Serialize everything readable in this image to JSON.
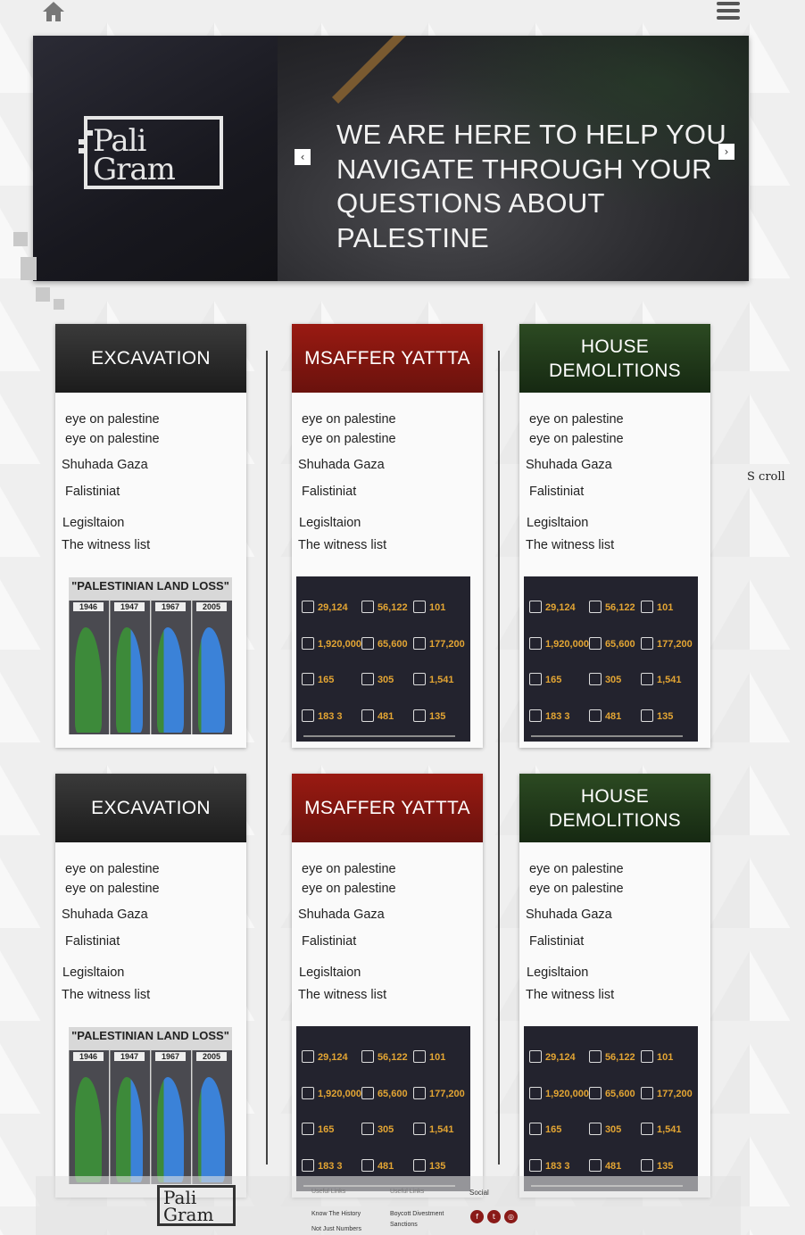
{
  "hero": {
    "logo_text": "Pali Gram",
    "headline": "WE ARE HERE TO HELP YOU NAVIGATE THROUGH YOUR QUESTIONS ABOUT PALESTINE",
    "prev_symbol": "‹",
    "next_symbol": "›"
  },
  "scroll_label": "S croll",
  "cards": [
    {
      "title": "EXCAVATION",
      "links": [
        "eye on palestine",
        "eye on palestine",
        "Shuhada Gaza",
        "Falistiniat",
        "Legisltaion",
        "The witness list"
      ],
      "image": "palestinian-land-loss-map"
    },
    {
      "title": "MSAFFER YATTTA",
      "links": [
        "eye on palestine",
        "eye on palestine",
        "Shuhada Gaza",
        "Falistiniat",
        "Legisltaion",
        "The witness list"
      ],
      "image": "gaza-statistics-infographic"
    },
    {
      "title": "HOUSE DEMOLITIONS",
      "links": [
        "eye on palestine",
        "eye on palestine",
        "Shuhada Gaza",
        "Falistiniat",
        "Legisltaion",
        "The witness list"
      ],
      "image": "gaza-statistics-infographic"
    },
    {
      "title": "EXCAVATION",
      "links": [
        "eye on palestine",
        "eye on palestine",
        "Shuhada Gaza",
        "Falistiniat",
        "Legisltaion",
        "The witness list"
      ],
      "image": "palestinian-land-loss-map"
    },
    {
      "title": "MSAFFER YATTTA",
      "links": [
        "eye on palestine",
        "eye on palestine",
        "Shuhada Gaza",
        "Falistiniat",
        "Legisltaion",
        "The witness list"
      ],
      "image": "gaza-statistics-infographic"
    },
    {
      "title": "HOUSE DEMOLITIONS",
      "links": [
        "eye on palestine",
        "eye on palestine",
        "Shuhada Gaza",
        "Falistiniat",
        "Legisltaion",
        "The witness list"
      ],
      "image": "gaza-statistics-infographic"
    }
  ],
  "land_loss": {
    "title": "\"PALESTINIAN LAND LOSS\"",
    "years": [
      "1946",
      "1947",
      "1967",
      "2005"
    ]
  },
  "infographic": {
    "values": [
      "29,124",
      "56,122",
      "101",
      "1,920,000",
      "65,600",
      "177,200",
      "165",
      "305",
      "1,541",
      "183  3",
      "481",
      "135"
    ]
  },
  "footer": {
    "logo_text": "Pali Gram",
    "useful_links_1": "Useful Links",
    "useful_links_2": "Useful Links",
    "social": "Social",
    "link_history": "Know The History",
    "link_numbers": "Not Just Numbers",
    "link_bds_1": "Boycott Divestment",
    "link_bds_2": "Sanctions",
    "social_icons": [
      "facebook-icon",
      "twitter-icon",
      "instagram-icon"
    ]
  },
  "colors": {
    "header_dark": "#1c1c1c",
    "header_red": "#7a140e",
    "header_green": "#1f3819",
    "social": "#8a1a18",
    "infographic_bg": "#23232e",
    "infographic_accent": "#e3a533"
  }
}
